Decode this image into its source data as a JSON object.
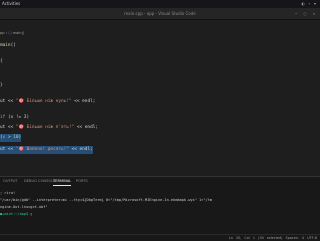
{
  "topbar": {
    "activities": "Activities",
    "clock": "",
    "system_icons": "◐ ⌁ ▾"
  },
  "window": {
    "title": "main.cpp - app - Visual Studio Code",
    "controls": "— ▢ ✕"
  },
  "breadcrumb": {
    "part1": "pp",
    "part2": "main()"
  },
  "code": {
    "l1": {
      "fn": "main",
      "rest": "()"
    },
    "l2": "{",
    "l3": "}",
    "l4": {
      "stream": "ut << ",
      "str": "\"🎯 Більше ніж нуль!\"",
      "tail": " << endl;"
    },
    "l5": {
      "kw": "if",
      "rest": " (x != 3)"
    },
    "l6": {
      "stream": "ut << ",
      "str": "\"🎯 Більше ніж п'ять!\"",
      "tail": " << endl;"
    },
    "l7": {
      "head": "(",
      "var": "x",
      "op": " > ",
      "num": "10",
      "tail": ")"
    },
    "l8": {
      "stream": "ut << ",
      "str": "\"🎯 Шалено! десять!\"",
      "tail": " << endl;"
    }
  },
  "panel": {
    "tabs": {
      "output": "OUTPUT",
      "debug_console": "DEBUG CONSOLE",
      "terminal": "TERMINAL",
      "ports": "PORTS"
    },
    "terminal": {
      "line1": "; гіто!",
      "line2": "\"/usr/bin/gdb\" --interpreter=mi --tty=${DbgTerm} 0<\"/tmp/Microsoft-MIEngine-In-ekmkmpk.wyx\" 1>\"/tm",
      "line3": "ngine-Out-lnscgct.obf\"",
      "line4_prompt": "●→mint:~/app$",
      "line4_cursor": " ▯"
    }
  },
  "status": {
    "left": "",
    "right": "Ln 20, Col 1 (30 selected)   Spaces: 4   UTF-8"
  }
}
